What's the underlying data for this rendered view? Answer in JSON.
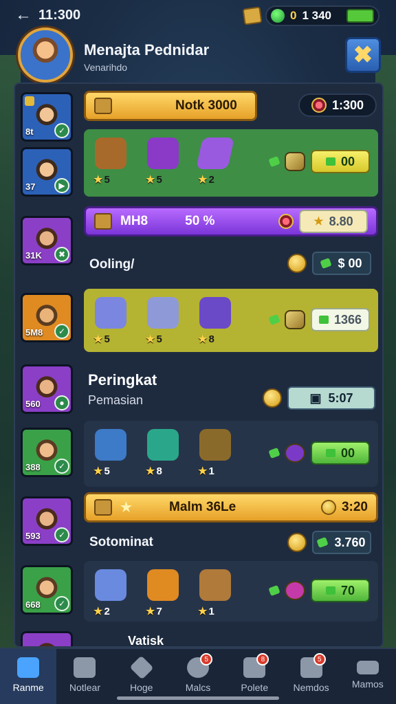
{
  "status": {
    "time": "11:300",
    "gems": "0",
    "coins": "1 340"
  },
  "header": {
    "title": "Menajta Pednidar",
    "subtitle": "Venarihdo",
    "close_icon": "close-x-icon"
  },
  "rows": [
    {
      "tile_num": "8t",
      "banner": "Notk 3000",
      "timer": "1:300",
      "items": [
        {
          "stars": "★",
          "n": "5"
        },
        {
          "stars": "★",
          "n": "5"
        },
        {
          "stars": "★",
          "n": "2"
        }
      ],
      "price": "00",
      "tile2_num": "37"
    },
    {
      "tile_num": "31K",
      "banner_left": "MH8",
      "banner": "50 %",
      "price": "8.80",
      "label": "Ooling/",
      "price2": "$ 00"
    },
    {
      "tile_num": "5M8",
      "items": [
        {
          "stars": "★",
          "n": "5"
        },
        {
          "stars": "★",
          "n": "5"
        },
        {
          "stars": "★",
          "n": "8"
        }
      ],
      "price": "1366"
    },
    {
      "tile_num": "560",
      "heading": "Peringkat",
      "subheading": "Pemasian",
      "timer": "5:07"
    },
    {
      "tile_num": "388",
      "items": [
        {
          "stars": "★",
          "n": "5"
        },
        {
          "stars": "★",
          "n": "8"
        },
        {
          "stars": "★",
          "n": "1"
        }
      ],
      "price": "00"
    },
    {
      "tile_num": "593",
      "banner": "Malm 36Le",
      "banner_right": "3:20",
      "label": "Sotominat",
      "price": "3.760"
    },
    {
      "tile_num": "668",
      "items": [
        {
          "stars": "★",
          "n": "2"
        },
        {
          "stars": "★",
          "n": "7"
        },
        {
          "stars": "★",
          "n": "1"
        }
      ],
      "price": "70"
    },
    {
      "label": "Vatisk"
    }
  ],
  "nav": [
    {
      "label": "Ranme",
      "icon": "home-icon",
      "active": true
    },
    {
      "label": "Notlear",
      "icon": "house-icon"
    },
    {
      "label": "Hoge",
      "icon": "diamond-icon"
    },
    {
      "label": "Malcs",
      "icon": "globe-icon",
      "badge": "5"
    },
    {
      "label": "Polete",
      "icon": "card-icon",
      "badge": "8"
    },
    {
      "label": "Nemdos",
      "icon": "chest-icon",
      "badge": "5"
    },
    {
      "label": "Mamos",
      "icon": "menu-icon"
    }
  ]
}
